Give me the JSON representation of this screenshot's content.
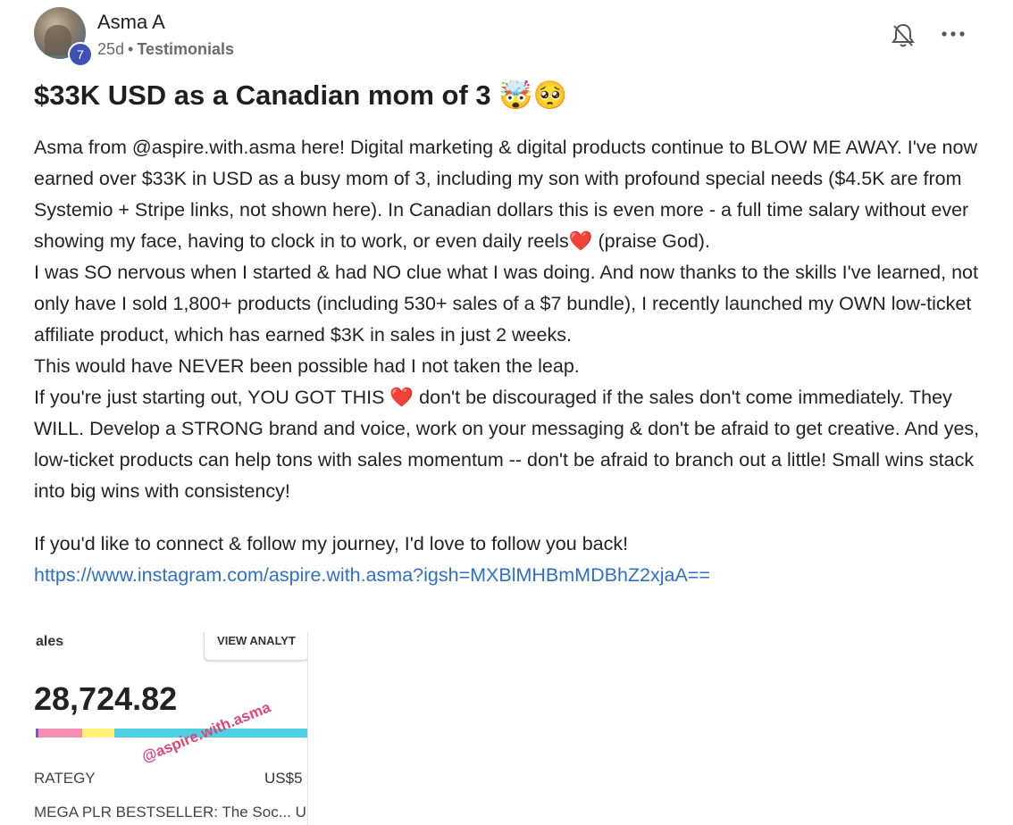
{
  "post": {
    "author": "Asma A",
    "level": "7",
    "time_ago": "25d",
    "separator": "•",
    "category": "Testimonials",
    "title": "$33K USD as a Canadian mom of 3",
    "title_emojis": "🤯🥺",
    "paragraphs": {
      "p1_before_heart": "Asma from @aspire.with.asma here! Digital marketing & digital products continue to BLOW ME AWAY. I've now earned over $33K in USD as a busy mom of 3, including my son with profound special needs ($4.5K are from Systemio + Stripe links, not shown here). In Canadian dollars this is even more - a full time salary without ever showing my face, having to clock in to work, or even daily reels",
      "p1_after_heart": " (praise God).",
      "p2": "I was SO nervous when I started & had NO clue what I was doing. And now thanks to the skills I've learned, not only have I sold 1,800+ products (including 530+ sales of a $7 bundle), I recently launched my OWN low-ticket affiliate product, which has earned $3K in sales in just 2 weeks.",
      "p3": "This would have NEVER been possible had I not taken the leap.",
      "p4_before_heart": "If you're just starting out, YOU GOT THIS ",
      "p4_after_heart": " don't be discouraged if the sales don't come immediately. They WILL. Develop a STRONG brand and voice, work on your messaging & don't be afraid to get creative. And yes, low-ticket products can help tons with sales momentum -- don't be afraid to branch out a little! Small wins stack into big wins with consistency!",
      "p5": "If you'd like to connect & follow my journey, I'd love to follow you back!",
      "link": "https://www.instagram.com/aspire.with.asma?igsh=MXBlMHBmMDBhZ2xjaA=="
    },
    "heart": "❤️"
  },
  "attachment": {
    "sales_label": "ales",
    "view_analytics_label": "VIEW ANALYT",
    "amount": "28,724.82",
    "watermark": "@aspire.with.asma",
    "strategy_label": "RATEGY",
    "price": "US$5",
    "product": "MEGA PLR BESTSELLER: The Soc... US",
    "bar_colors": [
      "#7e57c2",
      "#f48fb1",
      "#fff176",
      "#4dd0e1"
    ],
    "bar_fractions": [
      0.01,
      0.16,
      0.12,
      0.71
    ]
  },
  "icons": {
    "bell": "bell-off-icon",
    "more": "more-horizontal-icon"
  }
}
